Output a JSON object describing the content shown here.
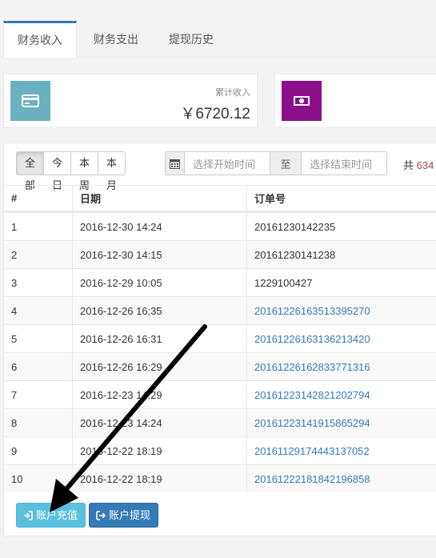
{
  "tabs": [
    {
      "label": "财务收入",
      "active": true
    },
    {
      "label": "财务支出",
      "active": false
    },
    {
      "label": "提现历史",
      "active": false
    }
  ],
  "stats": [
    {
      "icon": "credit-card-icon",
      "color": "#6ab0c0",
      "label": "累计收入",
      "value": "￥6720.12"
    },
    {
      "icon": "money-icon",
      "color": "#8b0f8b",
      "label": "",
      "value": ""
    }
  ],
  "filters": {
    "ranges": [
      "全部",
      "今日",
      "本周",
      "本月"
    ],
    "active_range": "全部",
    "start_placeholder": "选择开始时间",
    "separator": "至",
    "end_placeholder": "选择结束时间",
    "total_prefix": "共",
    "total_count": "634"
  },
  "table": {
    "headers": [
      "#",
      "日期",
      "订单号"
    ],
    "rows": [
      {
        "no": "1",
        "date": "2016-12-30 14:24",
        "order": "20161230142235",
        "link": false
      },
      {
        "no": "2",
        "date": "2016-12-30 14:15",
        "order": "20161230141238",
        "link": false
      },
      {
        "no": "3",
        "date": "2016-12-29 10:05",
        "order": "1229100427",
        "link": false
      },
      {
        "no": "4",
        "date": "2016-12-26 16:35",
        "order": "20161226163513395270",
        "link": true
      },
      {
        "no": "5",
        "date": "2016-12-26 16:31",
        "order": "20161226163136213420",
        "link": true
      },
      {
        "no": "6",
        "date": "2016-12-26 16:29",
        "order": "20161226162833771316",
        "link": true
      },
      {
        "no": "7",
        "date": "2016-12-23 14:29",
        "order": "20161223142821202794",
        "link": true
      },
      {
        "no": "8",
        "date": "2016-12-23 14:24",
        "order": "20161223141915865294",
        "link": true
      },
      {
        "no": "9",
        "date": "2016-12-22 18:19",
        "order": "20161129174443137052",
        "link": true
      },
      {
        "no": "10",
        "date": "2016-12-22 18:19",
        "order": "20161222181842196858",
        "link": true
      }
    ]
  },
  "actions": {
    "recharge_label": "账户充值",
    "withdraw_label": "账户提现"
  },
  "colors": {
    "accent": "#337ab7",
    "info": "#5bc0de",
    "annotation_arrow": "#000000"
  }
}
